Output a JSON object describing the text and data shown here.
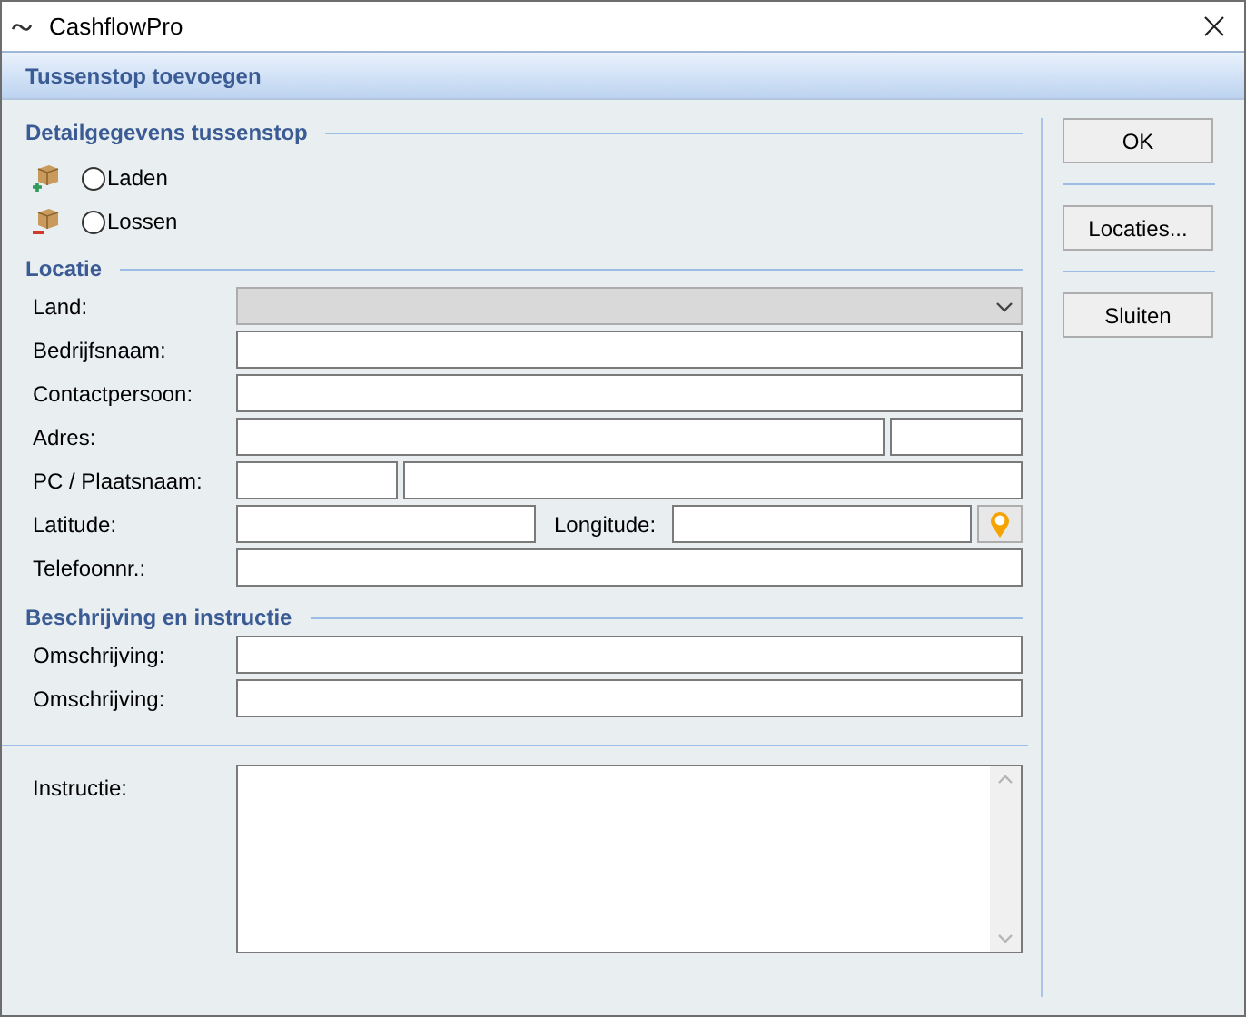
{
  "window": {
    "title": "CashflowPro"
  },
  "header": {
    "title": "Tussenstop toevoegen"
  },
  "detail": {
    "title": "Detailgegevens tussenstop",
    "options": [
      {
        "label": "Laden",
        "kind": "load",
        "selected": false
      },
      {
        "label": "Lossen",
        "kind": "unload",
        "selected": false
      }
    ]
  },
  "location": {
    "title": "Locatie",
    "fields": [
      {
        "label": "Land:",
        "kind": "select"
      },
      {
        "label": "Bedrijfsnaam:",
        "kind": "text"
      },
      {
        "label": "Contactpersoon:",
        "kind": "text"
      },
      {
        "label": "Adres:",
        "kind": "address"
      },
      {
        "label": "PC / Plaatsnaam:",
        "kind": "postal"
      },
      {
        "label": "Latitude:",
        "kind": "coords",
        "second_label": "Longitude:"
      },
      {
        "label": "Telefoonnr.:",
        "kind": "text"
      }
    ]
  },
  "description": {
    "title": "Beschrijving en instructie",
    "fields": [
      {
        "label": "Omschrijving:"
      },
      {
        "label": "Omschrijving:"
      }
    ]
  },
  "instruction": {
    "label": "Instructie:"
  },
  "buttons": [
    {
      "label": "OK"
    },
    {
      "label": "Locaties..."
    },
    {
      "label": "Sluiten"
    }
  ]
}
